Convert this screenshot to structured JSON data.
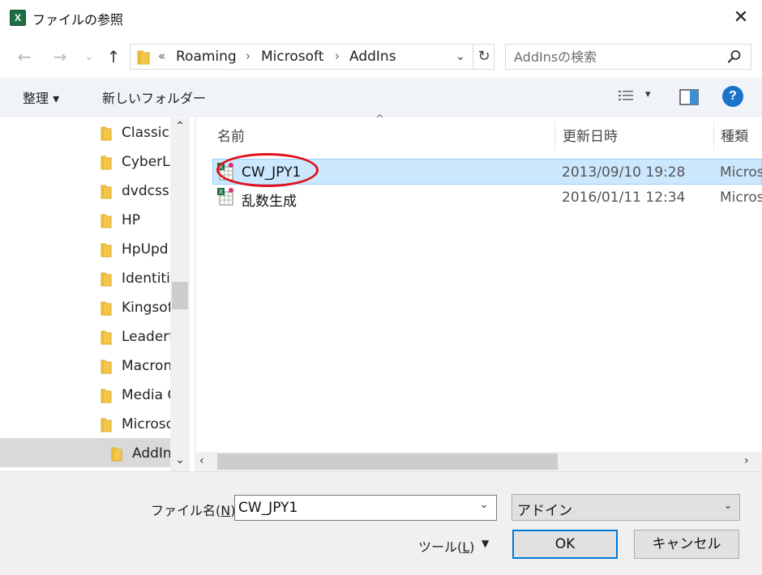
{
  "window": {
    "title": "ファイルの参照",
    "app_icon_glyph": "X",
    "close_glyph": "✕"
  },
  "nav": {
    "back_glyph": "←",
    "forward_glyph": "→",
    "recent_glyph": "⌄",
    "up_glyph": "↑",
    "address": {
      "chevron_start": "«",
      "crumbs": [
        "Roaming",
        "Microsoft",
        "AddIns"
      ],
      "separator": "›",
      "dropdown_glyph": "⌄",
      "refresh_glyph": "↻"
    },
    "search": {
      "placeholder": "AddInsの検索",
      "value": ""
    }
  },
  "command_bar": {
    "organize_label": "整理 ▾",
    "new_folder_label": "新しいフォルダー",
    "view_dropdown_glyph": "▾",
    "help_glyph": "?"
  },
  "tree": {
    "items": [
      {
        "label": "ClassicS",
        "indent": 0
      },
      {
        "label": "CyberLi",
        "indent": 0
      },
      {
        "label": "dvdcss",
        "indent": 0
      },
      {
        "label": "HP",
        "indent": 0
      },
      {
        "label": "HpUpd",
        "indent": 0
      },
      {
        "label": "Identitie",
        "indent": 0
      },
      {
        "label": "Kingsof",
        "indent": 0
      },
      {
        "label": "Leadert",
        "indent": 0
      },
      {
        "label": "Macron",
        "indent": 0
      },
      {
        "label": "Media C",
        "indent": 0
      },
      {
        "label": "Microsc",
        "indent": 0
      },
      {
        "label": "AddIn",
        "indent": 1,
        "selected": true
      }
    ],
    "scroll_up_glyph": "⌃",
    "scroll_down_glyph": "⌄"
  },
  "files": {
    "columns": {
      "name": "名前",
      "date": "更新日時",
      "type": "種類",
      "sort_glyph": "^"
    },
    "rows": [
      {
        "name": "CW_JPY1",
        "date": "2013/09/10 19:28",
        "type": "Micros",
        "selected": true
      },
      {
        "name": "乱数生成",
        "date": "2016/01/11 12:34",
        "type": "Micros",
        "selected": false
      }
    ],
    "hscroll_left_glyph": "‹",
    "hscroll_right_glyph": "›"
  },
  "bottom": {
    "filename_label_prefix": "ファイル名(",
    "filename_label_key": "N",
    "filename_label_suffix": "):",
    "filename_value": "CW_JPY1",
    "filename_dd_glyph": "⌄",
    "filetype_value": "アドイン",
    "filetype_dd_glyph": "⌄",
    "tools_label_prefix": "ツール(",
    "tools_label_key": "L",
    "tools_label_suffix": ")",
    "tools_dd_glyph": "▼",
    "ok_label": "OK",
    "cancel_label": "キャンセル"
  },
  "colors": {
    "selection": "#cce8ff",
    "accent": "#0078d7",
    "highlight_ring": "#e0111c",
    "folder": "#f3c84a"
  }
}
